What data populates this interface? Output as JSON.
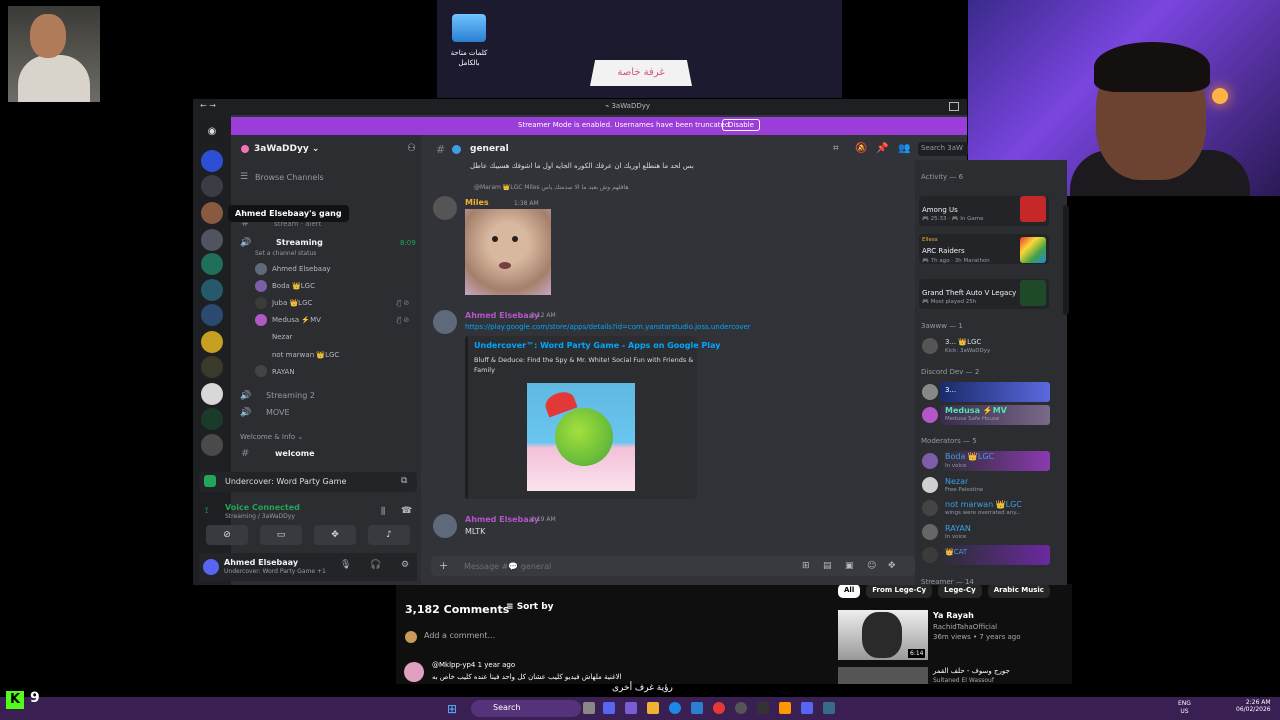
{
  "desktop": {
    "icon_label": "كلمات متاحة بالكامل",
    "sign_text": "غرفة خاصة"
  },
  "discord": {
    "window_title": "3aWaDDyy",
    "streamer_banner": "Streamer Mode is enabled. Usernames have been truncated.",
    "streamer_disable": "Disable",
    "guild_name": "3aWaDDyy ⌄",
    "browse_channels": "Browse Channels",
    "tooltip": "Ahmed Elsebaay's gang",
    "alert_channel": "stream · alert",
    "voice_channel": "Streaming",
    "voice_time": "8:09",
    "voice_status": "Set a channel status",
    "members": [
      {
        "name": "Ahmed Elsebaay",
        "color": "#dbdee1"
      },
      {
        "name": "Boda 👑LGC",
        "color": "#b5bac1"
      },
      {
        "name": "Juba 👑LGC",
        "color": "#b5bac1"
      },
      {
        "name": "Medusa ⚡️MV",
        "color": "#b5bac1"
      },
      {
        "name": "Nezar",
        "color": "#949ba4"
      },
      {
        "name": "not marwan 👑LGC",
        "color": "#949ba4"
      },
      {
        "name": "RAYAN",
        "color": "#949ba4"
      }
    ],
    "voice_channel_2": "Streaming 2",
    "voice_channel_3": "MOVE",
    "category": "Welcome & Info ⌄",
    "welcome_channel": "welcome",
    "activity": "Undercover: Word Party Game",
    "voice_connected": "Voice Connected",
    "voice_location": "Streaming / 3aWaDDyy",
    "user_name": "Ahmed Elsebaay",
    "user_status": "Undercover: Word Party Game +1",
    "chat": {
      "channel": "general",
      "search": "Search 3aW",
      "arabic_line": "بس لحد ما هنطلع اوريك ان عرفك الكوره الجايه اول ما اشوفك هسيبك عاطل",
      "reply_preview": "@Maram 👑LGC Miles هاقلهم وش بعيد ما الا صدمتك ياس",
      "msg1_user": "Miles",
      "msg1_time": "1:38 AM",
      "msg2_user": "Ahmed Elsebaay",
      "msg2_time": "2:12 AM",
      "msg2_link": "https://play.google.com/store/apps/details?id=com.yanstarstudio.joss.undercover",
      "embed_title": "Undercover™: Word Party Game - Apps on Google Play",
      "embed_desc": "Bluff & Deduce: Find the Spy & Mr. White! Social Fun with Friends & Family",
      "msg3_user": "Ahmed Elsebaay",
      "msg3_time": "2:19 AM",
      "msg3_text": "MLTK",
      "composer_placeholder": "Message #💬 general"
    },
    "member_list": {
      "activity_header": "Activity — 6",
      "act1_name": "Among Us",
      "act1_sub": "🎮 25:33 · 🎮 In Game",
      "act2_user": "Elless",
      "act2_name": "ARC Raiders",
      "act2_sub": "🎮 7h ago · 3h Marathon",
      "act3_name": "Grand Theft Auto V Legacy",
      "act3_sub": "🎮 Most played 25h",
      "group1": "3awww — 1",
      "g1_name": "3... 👑LGC",
      "g1_sub": "Kick: 3aWaDDyy",
      "group2": "Discord Dev — 2",
      "g2_name1": "3...",
      "g2_name2": "Medusa ⚡️MV",
      "g2_sub2": "Medusa Safe House",
      "group3": "Moderators — 5",
      "mods": [
        {
          "name": "Boda 👑LGC",
          "sub": "In voice",
          "color": "#3ba0e6"
        },
        {
          "name": "Nezar",
          "sub": "Free Palestine",
          "color": "#3ba0e6"
        },
        {
          "name": "not marwan 👑LGC",
          "sub": "wings were overrated any...",
          "color": "#3ba0e6"
        },
        {
          "name": "RAYAN",
          "sub": "In voice",
          "color": "#3ba0e6"
        },
        {
          "name": "👑CAT",
          "sub": "",
          "color": "#3ba0e6"
        }
      ],
      "group4": "Streamer — 14"
    }
  },
  "youtube": {
    "comments_count": "3,182 Comments",
    "sort_by": "Sort by",
    "add_comment": "Add a comment...",
    "comment_user": "@Mklpp-yp4  1 year ago",
    "comment_text": "الاغنية ملهاش فيديو كليب عشان كل واحد فينا عنده كليب خاص به",
    "chips": [
      "All",
      "From Lege-Cy",
      "Lege-Cy",
      "Arabic Music"
    ],
    "video_title": "Ya Rayah",
    "video_channel": "RachidTahaOfficial",
    "video_meta": "36m views • 7 years ago",
    "video_duration": "6:14",
    "video2_title": "جورج وسوف - حلف القمر",
    "video2_channel": "Sultaned El Wassouf"
  },
  "bottom_text": "رؤية غرف أخرى",
  "taskbar": {
    "search": "Search",
    "lang": "ENG\nUS",
    "time": "2:26 AM",
    "date": "06/02/2026"
  },
  "overlay": {
    "kick_letter": "K",
    "kick_count": "9"
  }
}
